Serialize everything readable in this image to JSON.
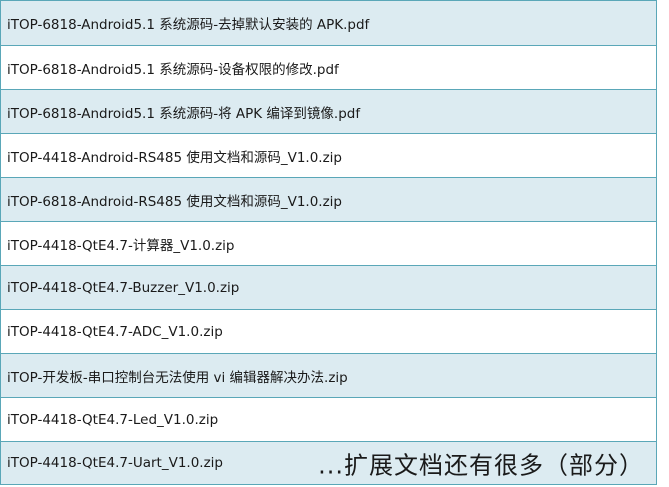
{
  "files": [
    {
      "name": "iTOP-6818-Android5.1 系统源码-去掉默认安装的 APK.pdf"
    },
    {
      "name": "iTOP-6818-Android5.1 系统源码-设备权限的修改.pdf"
    },
    {
      "name": "iTOP-6818-Android5.1 系统源码-将 APK 编译到镜像.pdf"
    },
    {
      "name": "iTOP-4418-Android-RS485 使用文档和源码_V1.0.zip"
    },
    {
      "name": "iTOP-6818-Android-RS485 使用文档和源码_V1.0.zip"
    },
    {
      "name": "iTOP-4418-QtE4.7-计算器_V1.0.zip"
    },
    {
      "name": "iTOP-4418-QtE4.7-Buzzer_V1.0.zip"
    },
    {
      "name": "iTOP-4418-QtE4.7-ADC_V1.0.zip"
    },
    {
      "name": "iTOP-开发板-串口控制台无法使用 vi 编辑器解决办法.zip"
    },
    {
      "name": "iTOP-4418-QtE4.7-Led_V1.0.zip"
    },
    {
      "name": "iTOP-4418-QtE4.7-Uart_V1.0.zip"
    }
  ],
  "overlay_note": "...扩展文档还有很多（部分）",
  "colors": {
    "row_alt": "#dcebf1",
    "row_plain": "#ffffff",
    "border": "#5aa7b8"
  }
}
